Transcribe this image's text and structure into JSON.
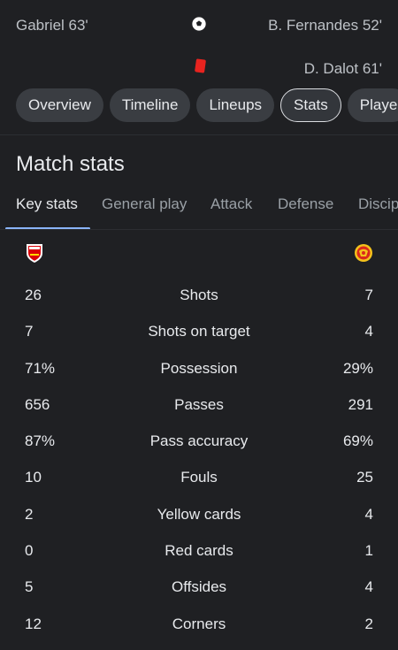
{
  "events": {
    "home_goal": "Gabriel 63'",
    "away_goal": "B. Fernandes 52'",
    "away_card": "D. Dalot 61'"
  },
  "tabs": [
    "Overview",
    "Timeline",
    "Lineups",
    "Stats",
    "Playe"
  ],
  "active_tab": "Stats",
  "section_title": "Match stats",
  "subtabs": [
    "Key stats",
    "General play",
    "Attack",
    "Defense",
    "Discip"
  ],
  "active_subtab": "Key stats",
  "teams": {
    "home_crest": "arsenal-crest",
    "away_crest": "manchester-united-crest"
  },
  "stats": [
    {
      "home": "26",
      "label": "Shots",
      "away": "7"
    },
    {
      "home": "7",
      "label": "Shots on target",
      "away": "4"
    },
    {
      "home": "71%",
      "label": "Possession",
      "away": "29%"
    },
    {
      "home": "656",
      "label": "Passes",
      "away": "291"
    },
    {
      "home": "87%",
      "label": "Pass accuracy",
      "away": "69%"
    },
    {
      "home": "10",
      "label": "Fouls",
      "away": "25"
    },
    {
      "home": "2",
      "label": "Yellow cards",
      "away": "4"
    },
    {
      "home": "0",
      "label": "Red cards",
      "away": "1"
    },
    {
      "home": "5",
      "label": "Offsides",
      "away": "4"
    },
    {
      "home": "12",
      "label": "Corners",
      "away": "2"
    }
  ],
  "colors": {
    "background": "#1f2023",
    "accent": "#8ab4f8",
    "red_card": "#e8231f"
  }
}
